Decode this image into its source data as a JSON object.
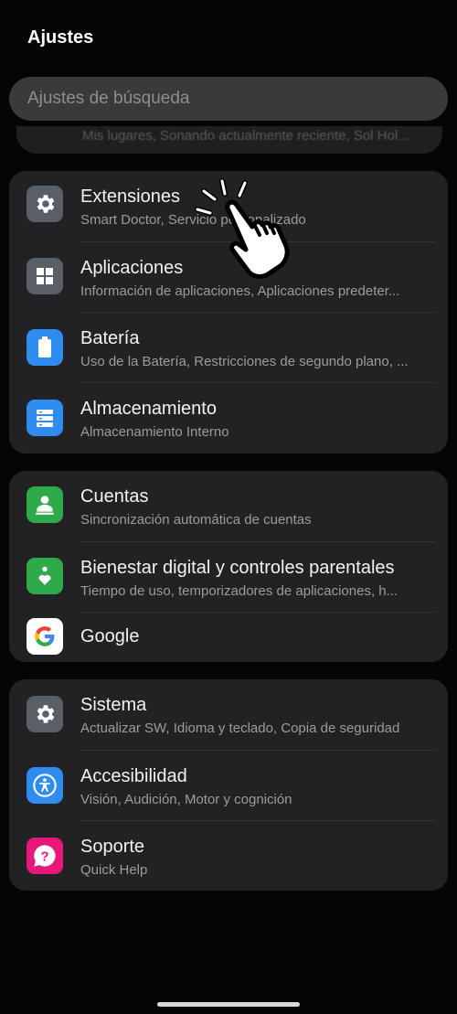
{
  "header": {
    "title": "Ajustes"
  },
  "search": {
    "placeholder": "Ajustes de búsqueda"
  },
  "peek": {
    "text": "Mis lugares, Sonando actualmente reciente, Sol Hol..."
  },
  "groups": [
    {
      "items": [
        {
          "label": "Extensiones",
          "sub": "Smart Doctor, Servicio personalizado",
          "icon": "gear-icon",
          "color": "#5a5e66"
        },
        {
          "label": "Aplicaciones",
          "sub": "Información de aplicaciones, Aplicaciones predeter...",
          "icon": "apps-grid-icon",
          "color": "#5a5e66"
        },
        {
          "label": "Batería",
          "sub": "Uso de la Batería, Restricciones de segundo plano, ...",
          "icon": "battery-icon",
          "color": "#2f8cf1"
        },
        {
          "label": "Almacenamiento",
          "sub": "Almacenamiento Interno",
          "icon": "storage-icon",
          "color": "#2f8cf1"
        }
      ]
    },
    {
      "items": [
        {
          "label": "Cuentas",
          "sub": "Sincronización automática de cuentas",
          "icon": "account-icon",
          "color": "#2eaa4b"
        },
        {
          "label": "Bienestar digital y controles parentales",
          "sub": "Tiempo de uso, temporizadores de aplicaciones, h...",
          "icon": "wellbeing-icon",
          "color": "#2eaa4b"
        },
        {
          "label": "Google",
          "sub": "",
          "icon": "google-icon",
          "color": "#ffffff"
        }
      ]
    },
    {
      "items": [
        {
          "label": "Sistema",
          "sub": "Actualizar SW, Idioma y teclado, Copia de seguridad",
          "icon": "gear-icon",
          "color": "#5a5e66"
        },
        {
          "label": "Accesibilidad",
          "sub": "Visión, Audición, Motor y cognición",
          "icon": "accessibility-icon",
          "color": "#2f8cf1"
        },
        {
          "label": "Soporte",
          "sub": "Quick Help",
          "icon": "help-icon",
          "color": "#e6197a"
        }
      ]
    }
  ]
}
